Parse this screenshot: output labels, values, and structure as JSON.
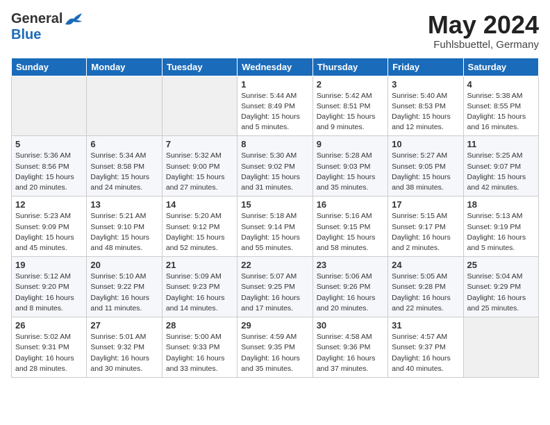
{
  "header": {
    "logo_general": "General",
    "logo_blue": "Blue",
    "month_title": "May 2024",
    "location": "Fuhlsbuettel, Germany"
  },
  "weekdays": [
    "Sunday",
    "Monday",
    "Tuesday",
    "Wednesday",
    "Thursday",
    "Friday",
    "Saturday"
  ],
  "weeks": [
    [
      {
        "day": "",
        "info": ""
      },
      {
        "day": "",
        "info": ""
      },
      {
        "day": "",
        "info": ""
      },
      {
        "day": "1",
        "info": "Sunrise: 5:44 AM\nSunset: 8:49 PM\nDaylight: 15 hours\nand 5 minutes."
      },
      {
        "day": "2",
        "info": "Sunrise: 5:42 AM\nSunset: 8:51 PM\nDaylight: 15 hours\nand 9 minutes."
      },
      {
        "day": "3",
        "info": "Sunrise: 5:40 AM\nSunset: 8:53 PM\nDaylight: 15 hours\nand 12 minutes."
      },
      {
        "day": "4",
        "info": "Sunrise: 5:38 AM\nSunset: 8:55 PM\nDaylight: 15 hours\nand 16 minutes."
      }
    ],
    [
      {
        "day": "5",
        "info": "Sunrise: 5:36 AM\nSunset: 8:56 PM\nDaylight: 15 hours\nand 20 minutes."
      },
      {
        "day": "6",
        "info": "Sunrise: 5:34 AM\nSunset: 8:58 PM\nDaylight: 15 hours\nand 24 minutes."
      },
      {
        "day": "7",
        "info": "Sunrise: 5:32 AM\nSunset: 9:00 PM\nDaylight: 15 hours\nand 27 minutes."
      },
      {
        "day": "8",
        "info": "Sunrise: 5:30 AM\nSunset: 9:02 PM\nDaylight: 15 hours\nand 31 minutes."
      },
      {
        "day": "9",
        "info": "Sunrise: 5:28 AM\nSunset: 9:03 PM\nDaylight: 15 hours\nand 35 minutes."
      },
      {
        "day": "10",
        "info": "Sunrise: 5:27 AM\nSunset: 9:05 PM\nDaylight: 15 hours\nand 38 minutes."
      },
      {
        "day": "11",
        "info": "Sunrise: 5:25 AM\nSunset: 9:07 PM\nDaylight: 15 hours\nand 42 minutes."
      }
    ],
    [
      {
        "day": "12",
        "info": "Sunrise: 5:23 AM\nSunset: 9:09 PM\nDaylight: 15 hours\nand 45 minutes."
      },
      {
        "day": "13",
        "info": "Sunrise: 5:21 AM\nSunset: 9:10 PM\nDaylight: 15 hours\nand 48 minutes."
      },
      {
        "day": "14",
        "info": "Sunrise: 5:20 AM\nSunset: 9:12 PM\nDaylight: 15 hours\nand 52 minutes."
      },
      {
        "day": "15",
        "info": "Sunrise: 5:18 AM\nSunset: 9:14 PM\nDaylight: 15 hours\nand 55 minutes."
      },
      {
        "day": "16",
        "info": "Sunrise: 5:16 AM\nSunset: 9:15 PM\nDaylight: 15 hours\nand 58 minutes."
      },
      {
        "day": "17",
        "info": "Sunrise: 5:15 AM\nSunset: 9:17 PM\nDaylight: 16 hours\nand 2 minutes."
      },
      {
        "day": "18",
        "info": "Sunrise: 5:13 AM\nSunset: 9:19 PM\nDaylight: 16 hours\nand 5 minutes."
      }
    ],
    [
      {
        "day": "19",
        "info": "Sunrise: 5:12 AM\nSunset: 9:20 PM\nDaylight: 16 hours\nand 8 minutes."
      },
      {
        "day": "20",
        "info": "Sunrise: 5:10 AM\nSunset: 9:22 PM\nDaylight: 16 hours\nand 11 minutes."
      },
      {
        "day": "21",
        "info": "Sunrise: 5:09 AM\nSunset: 9:23 PM\nDaylight: 16 hours\nand 14 minutes."
      },
      {
        "day": "22",
        "info": "Sunrise: 5:07 AM\nSunset: 9:25 PM\nDaylight: 16 hours\nand 17 minutes."
      },
      {
        "day": "23",
        "info": "Sunrise: 5:06 AM\nSunset: 9:26 PM\nDaylight: 16 hours\nand 20 minutes."
      },
      {
        "day": "24",
        "info": "Sunrise: 5:05 AM\nSunset: 9:28 PM\nDaylight: 16 hours\nand 22 minutes."
      },
      {
        "day": "25",
        "info": "Sunrise: 5:04 AM\nSunset: 9:29 PM\nDaylight: 16 hours\nand 25 minutes."
      }
    ],
    [
      {
        "day": "26",
        "info": "Sunrise: 5:02 AM\nSunset: 9:31 PM\nDaylight: 16 hours\nand 28 minutes."
      },
      {
        "day": "27",
        "info": "Sunrise: 5:01 AM\nSunset: 9:32 PM\nDaylight: 16 hours\nand 30 minutes."
      },
      {
        "day": "28",
        "info": "Sunrise: 5:00 AM\nSunset: 9:33 PM\nDaylight: 16 hours\nand 33 minutes."
      },
      {
        "day": "29",
        "info": "Sunrise: 4:59 AM\nSunset: 9:35 PM\nDaylight: 16 hours\nand 35 minutes."
      },
      {
        "day": "30",
        "info": "Sunrise: 4:58 AM\nSunset: 9:36 PM\nDaylight: 16 hours\nand 37 minutes."
      },
      {
        "day": "31",
        "info": "Sunrise: 4:57 AM\nSunset: 9:37 PM\nDaylight: 16 hours\nand 40 minutes."
      },
      {
        "day": "",
        "info": ""
      }
    ]
  ]
}
